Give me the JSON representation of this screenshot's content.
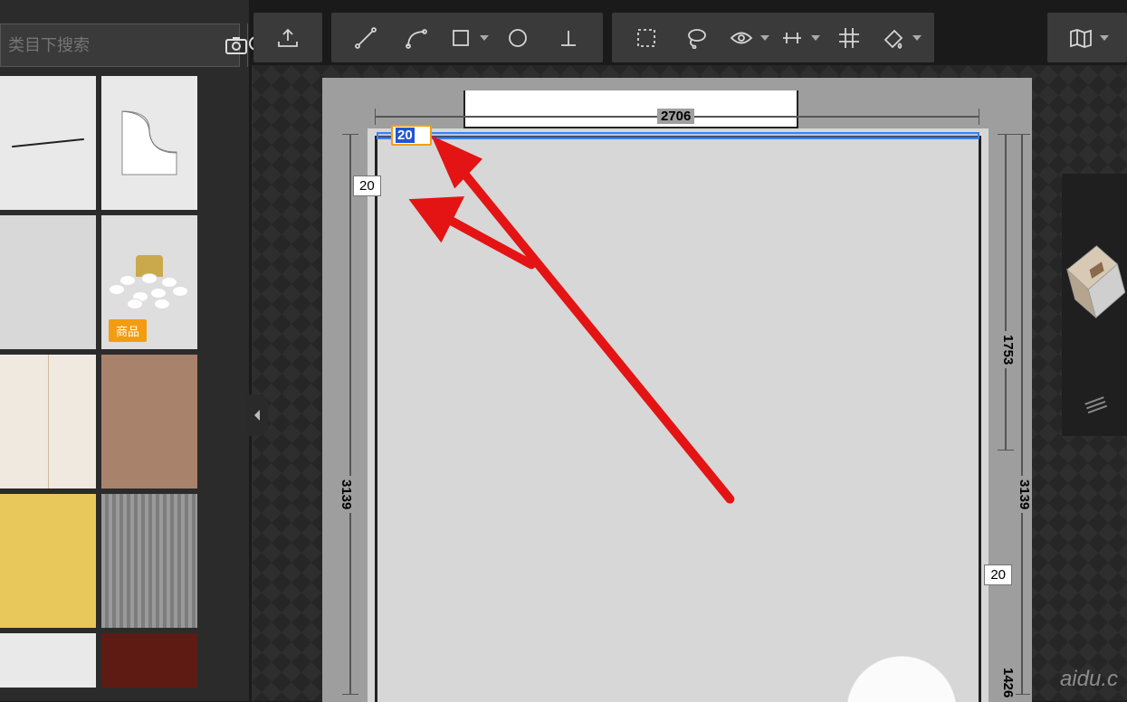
{
  "search": {
    "placeholder": "类目下搜索"
  },
  "sidebar": {
    "badge_label": "商品"
  },
  "toolbar": {
    "upload": "upload",
    "line": "line",
    "arc": "arc",
    "rect": "rect",
    "circle": "circle",
    "perp": "perp",
    "region": "region",
    "lasso": "lasso",
    "eye": "eye",
    "align": "align",
    "grid": "grid",
    "paint": "paint",
    "map": "map"
  },
  "dimensions": {
    "top_width": "2706",
    "left_height": "3139",
    "right_upper": "1753",
    "right_full": "3139",
    "right_bottom": "1426"
  },
  "offsets": {
    "input_value": "20",
    "left_offset": "20",
    "right_offset": "20"
  },
  "watermark": "aidu.c"
}
